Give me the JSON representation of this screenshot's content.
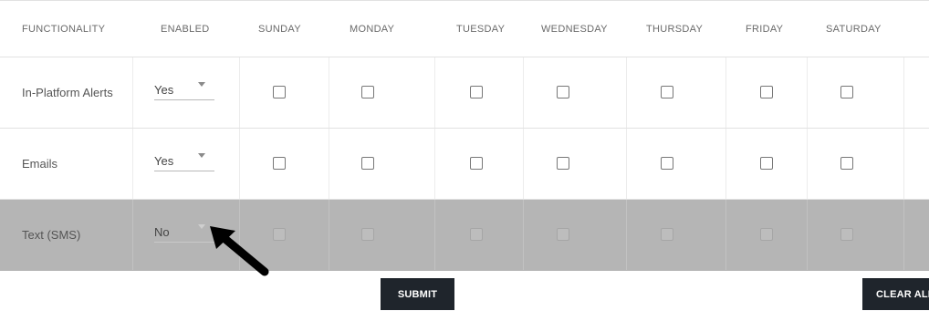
{
  "header": {
    "columns": [
      "FUNCTIONALITY",
      "ENABLED",
      "SUNDAY",
      "MONDAY",
      "TUESDAY",
      "WEDNESDAY",
      "THURSDAY",
      "FRIDAY",
      "SATURDAY"
    ]
  },
  "rows": [
    {
      "label": "In-Platform Alerts",
      "enabled": "Yes",
      "days": [
        false,
        false,
        false,
        false,
        false,
        false,
        false
      ]
    },
    {
      "label": "Emails",
      "enabled": "Yes",
      "days": [
        false,
        false,
        false,
        false,
        false,
        false,
        false
      ]
    },
    {
      "label": "Text (SMS)",
      "enabled": "No",
      "days": [
        false,
        false,
        false,
        false,
        false,
        false,
        false
      ]
    }
  ],
  "buttons": {
    "submit": "SUBMIT",
    "clear": "CLEAR ALL"
  },
  "icons": {
    "dropdown": "caret-down-icon",
    "pointer": "arrow-icon"
  },
  "colors": {
    "disabled_row": "#b5b5b5",
    "button_bg": "#1f252c",
    "arrow": "#000000"
  }
}
